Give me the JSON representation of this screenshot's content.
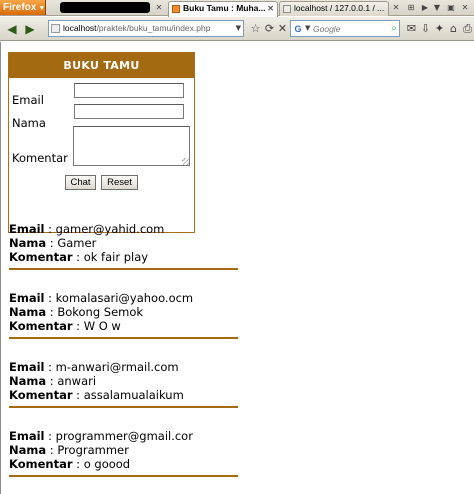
{
  "browser": {
    "menu_label": "Firefox",
    "tabs": [
      {
        "title": "",
        "redacted": true
      },
      {
        "title": "Buku Tamu : Muha...",
        "active": true
      },
      {
        "title": "localhost / 127.0.0.1 / ..."
      }
    ],
    "url": {
      "host": "localhost",
      "path": "/praktek/buku_tamu/index.php"
    },
    "search_engine": "G",
    "search_placeholder": "Google"
  },
  "form": {
    "title": "BUKU TAMU",
    "email_label": "Email",
    "nama_label": "Nama",
    "komentar_label": "Komentar",
    "email_value": "",
    "nama_value": "",
    "komentar_value": "",
    "chat_button": "Chat",
    "reset_button": "Reset"
  },
  "labels": {
    "email": "Email",
    "nama": "Nama",
    "komentar": "Komentar",
    "separator": " : "
  },
  "entries": [
    {
      "email": "gamer@yahid.com",
      "nama": "Gamer",
      "komentar": "ok fair play"
    },
    {
      "email": "komalasari@yahoo.ocm",
      "nama": "Bokong Semok",
      "komentar": "W O w"
    },
    {
      "email": "m-anwari@rmail.com",
      "nama": "anwari",
      "komentar": "assalamualaikum"
    },
    {
      "email": "programmer@gmail.cor",
      "nama": "Programmer",
      "komentar": "o goood"
    }
  ],
  "colors": {
    "accent": "#a36a11",
    "firefox_orange": "#e07b15"
  }
}
